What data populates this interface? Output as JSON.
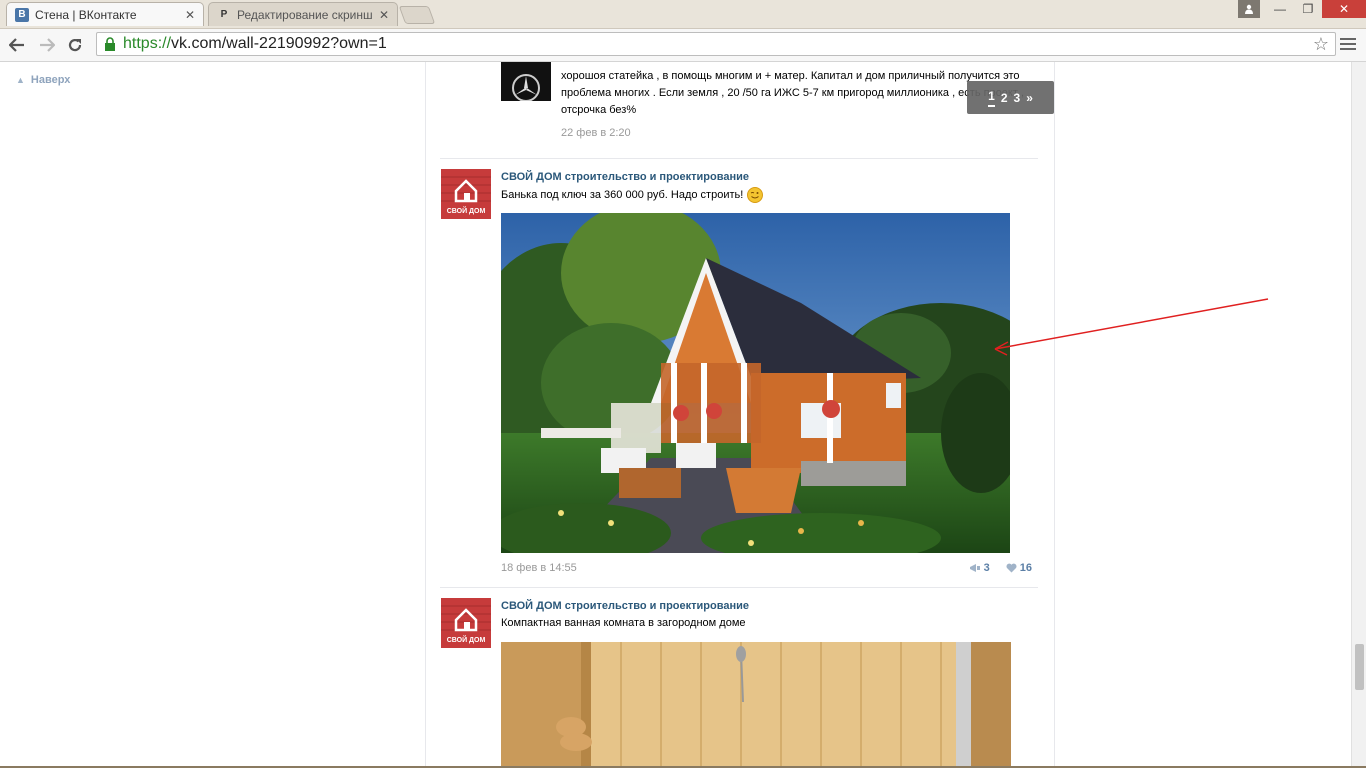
{
  "browser": {
    "tabs": [
      {
        "favicon": "В",
        "title": "Стена | ВКонтакте",
        "active": true
      },
      {
        "favicon": "P",
        "title": "Редактирование скринш",
        "active": false
      }
    ],
    "url_https": "https://",
    "url_rest": "vk.com/wall-22190992?own=1",
    "icons": {
      "back": "arrow-left-icon",
      "forward": "arrow-right-icon",
      "reload": "reload-icon",
      "lock": "lock-icon",
      "star": "star-icon",
      "menu": "menu-icon"
    }
  },
  "page": {
    "up_label": "Наверх",
    "reply": {
      "text": "хорошоя статейка , в помощь многим и + матер. Капитал и дом приличный получится это проблема многих . Если земля , 20 /50 га ИЖС 5-7 км пригород миллионика , есть проект , отсрочка без%",
      "date": "22 фев в 2:20"
    },
    "pager": {
      "pages": [
        "1",
        "2",
        "3"
      ],
      "next": "»"
    },
    "posts": [
      {
        "author": "СВОЙ ДОМ строительство и проектирование",
        "avatar_label": "СВОЙ ДОМ",
        "text": "Банька под ключ за 360 000 руб. Надо строить!",
        "date": "18 фев в 14:55",
        "reposts": "3",
        "likes": "16"
      },
      {
        "author": "СВОЙ ДОМ строительство и проектирование",
        "avatar_label": "СВОЙ ДОМ",
        "text": "Компактная ванная комната в загородном доме"
      }
    ]
  },
  "colors": {
    "accent": "#2b587a",
    "annotation": "#e02020"
  }
}
